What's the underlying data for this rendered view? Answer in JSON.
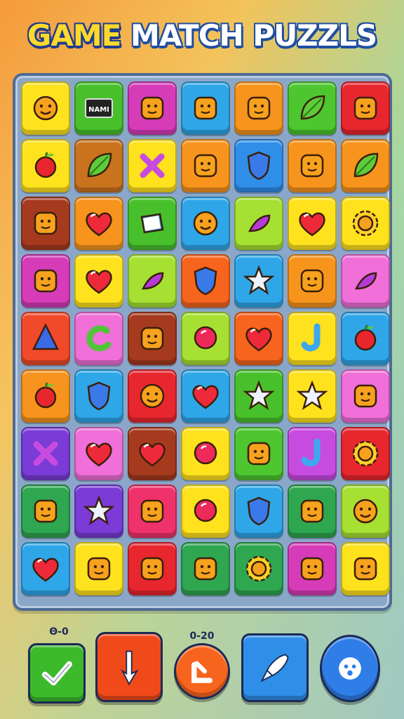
{
  "title": {
    "part1": "GAME",
    "part2": "MATCH PUZZLS"
  },
  "board": {
    "rows": [
      [
        {
          "icon": "smiley-face-icon",
          "color": "#ffe21e"
        },
        {
          "icon": "sign-icon",
          "color": "#48c02c",
          "text": "NAMI"
        },
        {
          "icon": "box-face-icon",
          "color": "#d63bb8"
        },
        {
          "icon": "bird-icon",
          "color": "#2fa6e8"
        },
        {
          "icon": "cat-face-icon",
          "color": "#f7941d"
        },
        {
          "icon": "leaf-drop-icon",
          "color": "#4dc62f"
        },
        {
          "icon": "square-face-icon",
          "color": "#e8262e"
        }
      ],
      [
        {
          "icon": "ball-icon",
          "color": "#ffe21e"
        },
        {
          "icon": "leaf-icon",
          "color": "#c9731e"
        },
        {
          "icon": "x-cross-icon",
          "color": "#ffe21e"
        },
        {
          "icon": "arrow-square-icon",
          "color": "#f7941d"
        },
        {
          "icon": "star-shield-icon",
          "color": "#2f8ee8"
        },
        {
          "icon": "fruit-icon",
          "color": "#f7941d"
        },
        {
          "icon": "leaf-icon",
          "color": "#f7941d"
        }
      ],
      [
        {
          "icon": "dog-face-icon",
          "color": "#a63a1e"
        },
        {
          "icon": "heart-icon",
          "color": "#f7941d"
        },
        {
          "icon": "book-icon",
          "color": "#48c02c"
        },
        {
          "icon": "sun-face-icon",
          "color": "#2fa6e8"
        },
        {
          "icon": "eggplant-icon",
          "color": "#a6e032"
        },
        {
          "icon": "heart-icon",
          "color": "#ffe21e"
        },
        {
          "icon": "flower-face-icon",
          "color": "#ffe21e"
        }
      ],
      [
        {
          "icon": "horseshoe-icon",
          "color": "#d63bb8"
        },
        {
          "icon": "heart-icon",
          "color": "#ffe21e"
        },
        {
          "icon": "pepper-icon",
          "color": "#a6e032"
        },
        {
          "icon": "shield-icon",
          "color": "#f7641d"
        },
        {
          "icon": "star-icon",
          "color": "#2fa6e8"
        },
        {
          "icon": "frog-icon",
          "color": "#f7941d"
        },
        {
          "icon": "banana-icon",
          "color": "#f06fd8"
        }
      ],
      [
        {
          "icon": "triangle-icon",
          "color": "#f04a2a"
        },
        {
          "icon": "c-letter-icon",
          "color": "#f06fd8"
        },
        {
          "icon": "shell-icon",
          "color": "#a63a1e"
        },
        {
          "icon": "balloon-icon",
          "color": "#a6e032"
        },
        {
          "icon": "heart-icon",
          "color": "#f7641d"
        },
        {
          "icon": "j-letter-icon",
          "color": "#ffe21e"
        },
        {
          "icon": "strawberry-icon",
          "color": "#2fa6e8"
        }
      ],
      [
        {
          "icon": "apple-icon",
          "color": "#f7941d"
        },
        {
          "icon": "water-drop-icon",
          "color": "#2fa6e8"
        },
        {
          "icon": "sun-face-icon",
          "color": "#e8262e"
        },
        {
          "icon": "heart-icon",
          "color": "#2fa6e8"
        },
        {
          "icon": "star-icon",
          "color": "#48c02c"
        },
        {
          "icon": "star-icon",
          "color": "#ffe21e"
        },
        {
          "icon": "cow-face-icon",
          "color": "#f06fd8"
        }
      ],
      [
        {
          "icon": "crossed-swords-icon",
          "color": "#7a3bd6"
        },
        {
          "icon": "heart-icon",
          "color": "#f06fd8"
        },
        {
          "icon": "heart-icon",
          "color": "#a63a1e"
        },
        {
          "icon": "balloon-icon",
          "color": "#ffe21e"
        },
        {
          "icon": "heart-check-icon",
          "color": "#4dc62f"
        },
        {
          "icon": "j-letter-icon",
          "color": "#c84be0"
        },
        {
          "icon": "gear-icon",
          "color": "#e8262e"
        }
      ],
      [
        {
          "icon": "fox-face-icon",
          "color": "#2fa650"
        },
        {
          "icon": "star-icon",
          "color": "#7a3bd6"
        },
        {
          "icon": "cat-face-icon",
          "color": "#f0326a"
        },
        {
          "icon": "ring-icon",
          "color": "#ffe21e"
        },
        {
          "icon": "u-shield-icon",
          "color": "#2fa6e8"
        },
        {
          "icon": "lemon-icon",
          "color": "#2fa650"
        },
        {
          "icon": "sun-face-icon",
          "color": "#a6e032"
        }
      ],
      [
        {
          "icon": "heart-icon",
          "color": "#2fa6e8"
        },
        {
          "icon": "sleepy-face-icon",
          "color": "#ffe21e"
        },
        {
          "icon": "square-knot-icon",
          "color": "#e8262e"
        },
        {
          "icon": "pinecone-icon",
          "color": "#2fa650"
        },
        {
          "icon": "flower-face-icon",
          "color": "#2fa650"
        },
        {
          "icon": "blob-face-icon",
          "color": "#d63bb8"
        },
        {
          "icon": "slime-face-icon",
          "color": "#ffe21e"
        }
      ]
    ]
  },
  "controls": {
    "buttons": [
      {
        "name": "confirm-button",
        "icon": "checkmark-icon",
        "label": "Θ-0",
        "color": "#3cba2c"
      },
      {
        "name": "undo-button",
        "icon": "arrow-down-icon",
        "label": "",
        "color": "#f04a1a"
      },
      {
        "name": "hint-button",
        "icon": "arrow-turn-icon",
        "label": "0-20",
        "color": "#f7641d"
      },
      {
        "name": "tool-button",
        "icon": "rocket-icon",
        "label": "",
        "color": "#2f8ee8"
      },
      {
        "name": "face-button",
        "icon": "face-icon",
        "label": "",
        "color": "#2f7ee8"
      }
    ]
  }
}
